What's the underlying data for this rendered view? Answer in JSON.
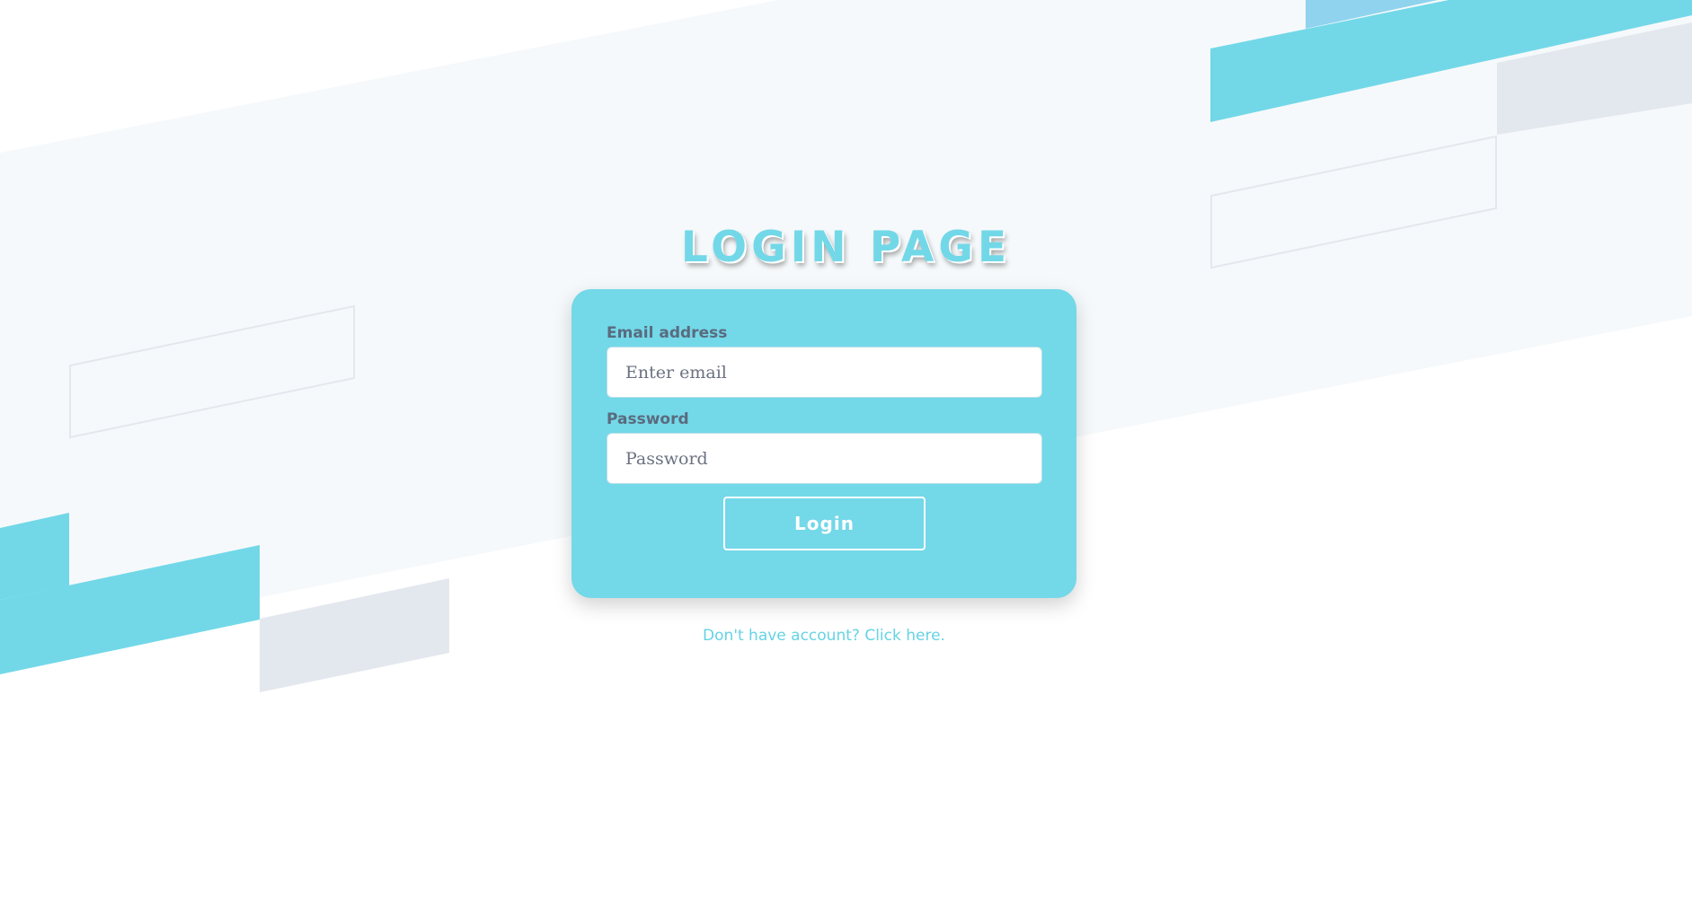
{
  "page": {
    "title": "LOGIN PAGE",
    "accent_color": "#73d8e8",
    "decor_gray": "#e3e8ee"
  },
  "form": {
    "email": {
      "label": "Email address",
      "placeholder": "Enter email",
      "value": ""
    },
    "password": {
      "label": "Password",
      "placeholder": "Password",
      "value": ""
    },
    "submit_label": "Login"
  },
  "footer": {
    "signup_link": "Don't have account? Click here."
  }
}
